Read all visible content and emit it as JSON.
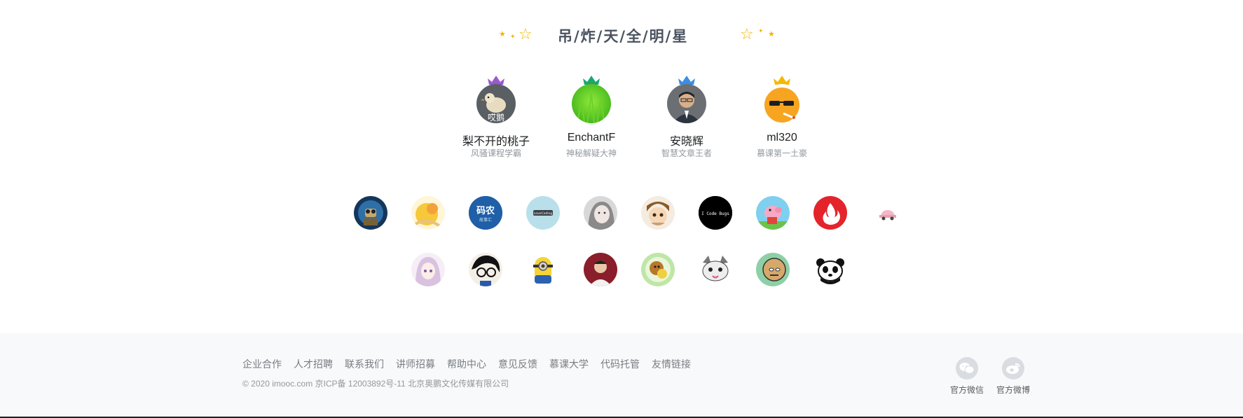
{
  "header": {
    "title": "吊/炸/天/全/明/星",
    "left_decoration": "star-cluster-left-icon",
    "right_decoration": "star-cluster-right-icon",
    "star_color": "#f4b400"
  },
  "leaders": [
    {
      "name": "梨不开的桃子",
      "title": "风骚课程学霸",
      "crown_color": "#9b59d0",
      "avatar_icon": "duck-avatar-icon",
      "avatar_text": "哎鹅"
    },
    {
      "name": "EnchantF",
      "title": "神秘解疑大神",
      "crown_color": "#1aa86b",
      "avatar_icon": "grass-avatar-icon"
    },
    {
      "name": "安晓辉",
      "title": "智慧文章王者",
      "crown_color": "#3a8ee6",
      "avatar_icon": "man-avatar-icon"
    },
    {
      "name": "ml320",
      "title": "慕课第一土豪",
      "crown_color": "#f5b800",
      "avatar_icon": "sunglasses-avatar-icon"
    }
  ],
  "members_row1": [
    {
      "icon": "robot-avatar-icon"
    },
    {
      "icon": "yellow-avatar-icon"
    },
    {
      "icon": "manong-avatar-icon",
      "text": "码农",
      "sub": "故事汇"
    },
    {
      "icon": "light-blue-avatar-icon",
      "text": "LoveCoding"
    },
    {
      "icon": "girl-avatar-icon"
    },
    {
      "icon": "cartoon-boy-avatar-icon"
    },
    {
      "icon": "code-bugs-avatar-icon",
      "text": "I Code Bugs"
    },
    {
      "icon": "peppa-avatar-icon"
    },
    {
      "icon": "flame-avatar-icon"
    },
    {
      "icon": "small-car-avatar-icon"
    }
  ],
  "members_row2": [
    {
      "icon": "anime-girl-avatar-icon"
    },
    {
      "icon": "conan-avatar-icon"
    },
    {
      "icon": "minion-avatar-icon"
    },
    {
      "icon": "man-photo-avatar-icon"
    },
    {
      "icon": "monkey-avatar-icon"
    },
    {
      "icon": "cat-avatar-icon"
    },
    {
      "icon": "bald-head-avatar-icon"
    },
    {
      "icon": "panda-avatar-icon"
    }
  ],
  "footer": {
    "links": [
      "企业合作",
      "人才招聘",
      "联系我们",
      "讲师招募",
      "帮助中心",
      "意见反馈",
      "慕课大学",
      "代码托管",
      "友情链接"
    ],
    "copyright": "© 2020 imooc.com 京ICP备 12003892号-11 北京奥鹏文化传媒有限公司",
    "social": [
      {
        "label": "官方微信",
        "icon": "wechat-icon"
      },
      {
        "label": "官方微博",
        "icon": "weibo-icon"
      }
    ]
  }
}
